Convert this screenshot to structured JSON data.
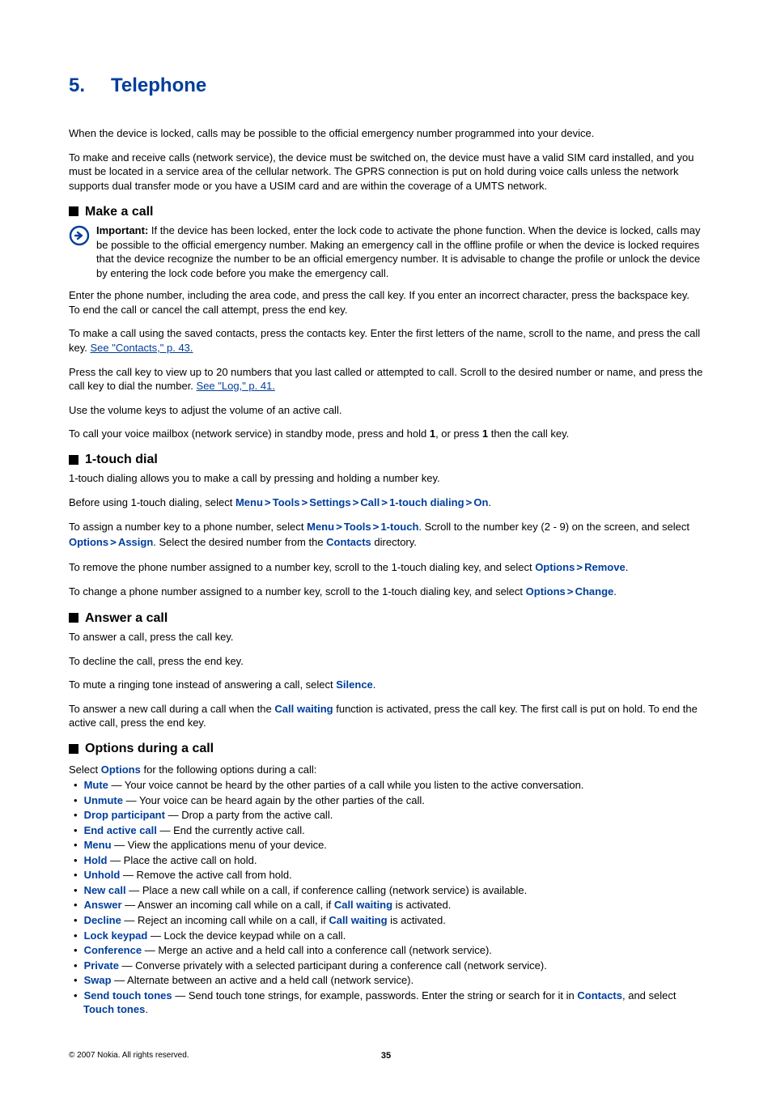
{
  "chapter": {
    "num": "5.",
    "title": "Telephone"
  },
  "intro": {
    "p1": "When the device is locked, calls may be possible to the official emergency number programmed into your device.",
    "p2": "To make and receive calls (network service), the device must be switched on, the device must have a valid SIM card installed, and you must be located in a service area of the cellular network. The GPRS connection is put on hold during voice calls unless the network supports dual transfer mode or you have a USIM card and are within the coverage of a UMTS network."
  },
  "make_call": {
    "heading": "Make a call",
    "important_label": "Important:",
    "important_body": "  If the device has been locked, enter the lock code to activate the phone function. When the device is locked, calls may be possible to the official emergency number. Making an emergency call in the offline profile or when the device is locked requires that the device recognize the number to be an official emergency number. It is advisable to change the profile or unlock the device by entering the lock code before you make the emergency call.",
    "p1": "Enter the phone number, including the area code, and press the call key. If you enter an incorrect character, press the backspace key. To end the call or cancel the call attempt, press the end key.",
    "p2a": "To make a call using the saved contacts, press the contacts key. Enter the first letters of the name, scroll to the name, and press the call key. ",
    "link1": "See \"Contacts,\" p. 43.",
    "p3a": "Press the call key to view up to 20 numbers that you last called or attempted to call. Scroll to the desired number or name, and press the call key to dial the number. ",
    "link2": "See \"Log,\" p. 41.",
    "p4": "Use the volume keys to adjust the volume of an active call.",
    "p5a": "To call your voice mailbox (network service) in standby mode, press and hold ",
    "p5b": ", or press ",
    "p5c": " then the call key.",
    "digit1a": "1",
    "digit1b": "1"
  },
  "one_touch": {
    "heading": "1-touch dial",
    "p1": "1-touch dialing allows you to make a call by pressing and holding a number key.",
    "p2a": "Before using 1-touch dialing, select ",
    "menu": "Menu",
    "tools": "Tools",
    "settings": "Settings",
    "call": "Call",
    "onetouchdialing": "1-touch dialing",
    "on": "On",
    "p3a": "To assign a number key to a phone number, select ",
    "onetouch": "1-touch",
    "p3b": ". Scroll to the number key (2 - 9) on the screen, and select ",
    "options": "Options",
    "assign": "Assign",
    "p3c": ". Select the desired number from the ",
    "contacts": "Contacts",
    "p3d": " directory.",
    "p4a": "To remove the phone number assigned to a number key, scroll to the 1-touch dialing key, and select ",
    "remove": "Remove",
    "p5a": "To change a phone number assigned to a number key, scroll to the 1-touch dialing key, and select ",
    "change": "Change"
  },
  "answer": {
    "heading": "Answer a call",
    "p1": "To answer a call, press the call key.",
    "p2": "To decline the call, press the end key.",
    "p3a": "To mute a ringing tone instead of answering a call, select ",
    "silence": "Silence",
    "p4a": "To answer a new call during a call when the ",
    "callwaiting": "Call waiting",
    "p4b": " function is activated, press the call key. The first call is put on hold. To end the active call, press the end key."
  },
  "options_call": {
    "heading": "Options during a call",
    "intro_a": "Select ",
    "options": "Options",
    "intro_b": " for the following options during a call:",
    "items": [
      {
        "term": "Mute",
        "desc": " — Your voice cannot be heard by the other parties of a call while you listen to the active conversation."
      },
      {
        "term": "Unmute",
        "desc": " — Your voice can be heard again by the other parties of the call."
      },
      {
        "term": "Drop participant",
        "desc": " — Drop a party from the active call."
      },
      {
        "term": "End active call",
        "desc": " — End the currently active call."
      },
      {
        "term": "Menu",
        "desc": " — View the applications menu of your device."
      },
      {
        "term": "Hold",
        "desc": " — Place the active call on hold."
      },
      {
        "term": "Unhold",
        "desc": " — Remove the active call from hold."
      },
      {
        "term": "New call",
        "desc": " — Place a new call while on a call, if conference calling (network service) is available."
      },
      {
        "term": "Answer",
        "desc_a": " — Answer an incoming call while on a call, if ",
        "inline_term": "Call waiting",
        "desc_b": " is activated."
      },
      {
        "term": "Decline",
        "desc_a": " — Reject an incoming call while on a call, if ",
        "inline_term": "Call waiting",
        "desc_b": " is activated."
      },
      {
        "term": "Lock keypad",
        "desc": " — Lock the device keypad while on a call."
      },
      {
        "term": "Conference",
        "desc": " — Merge an active and a held call into a conference call (network service)."
      },
      {
        "term": "Private",
        "desc": " — Converse privately with a selected participant during a conference call (network service)."
      },
      {
        "term": "Swap",
        "desc": " — Alternate between an active and a held call (network service)."
      },
      {
        "term": "Send touch tones",
        "desc_a": " — Send touch tone strings, for example, passwords. Enter the string or search for it in ",
        "inline_term": "Contacts",
        "desc_b": ", and select ",
        "inline_term2": "Touch tones",
        "desc_c": "."
      }
    ]
  },
  "footer": {
    "copyright": "© 2007 Nokia. All rights reserved.",
    "page": "35"
  }
}
